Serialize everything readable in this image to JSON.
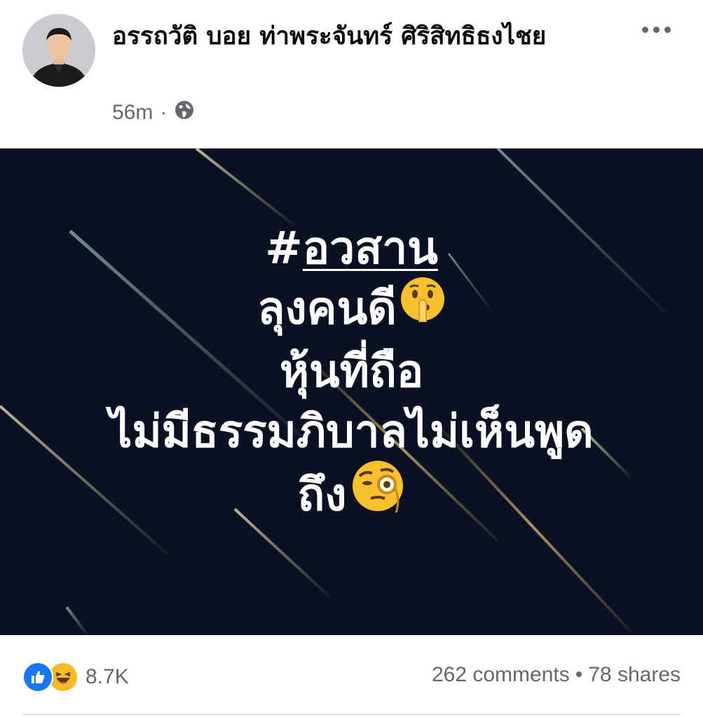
{
  "post": {
    "author": "อรรถวัติ บอย ท่าพระจันทร์ ศิริสิทธิธงไชย",
    "timestamp": "56m",
    "separator": "·",
    "privacy_icon": "globe-icon",
    "more_icon": "more-options-icon"
  },
  "image_text": {
    "hash": "#",
    "tag": "อวสาน",
    "line2": "ลุงคนดี",
    "line2_emoji": "shushing-face-emoji",
    "line3": "หุ้นที่ถือ",
    "line4": "ไม่มีธรรมภิบาลไม่เห็นพูด",
    "line5": "ถึง",
    "line5_emoji": "face-with-monocle-emoji"
  },
  "engagement": {
    "reaction_icons": [
      "like-icon",
      "haha-icon"
    ],
    "reaction_count": "8.7K",
    "comments": "262 comments",
    "bullet": "•",
    "shares": "78 shares"
  },
  "colors": {
    "image_background": "#0b1022",
    "like_blue": "#1877f2",
    "haha_yellow": "#f7b928",
    "secondary_text": "#65676b"
  }
}
